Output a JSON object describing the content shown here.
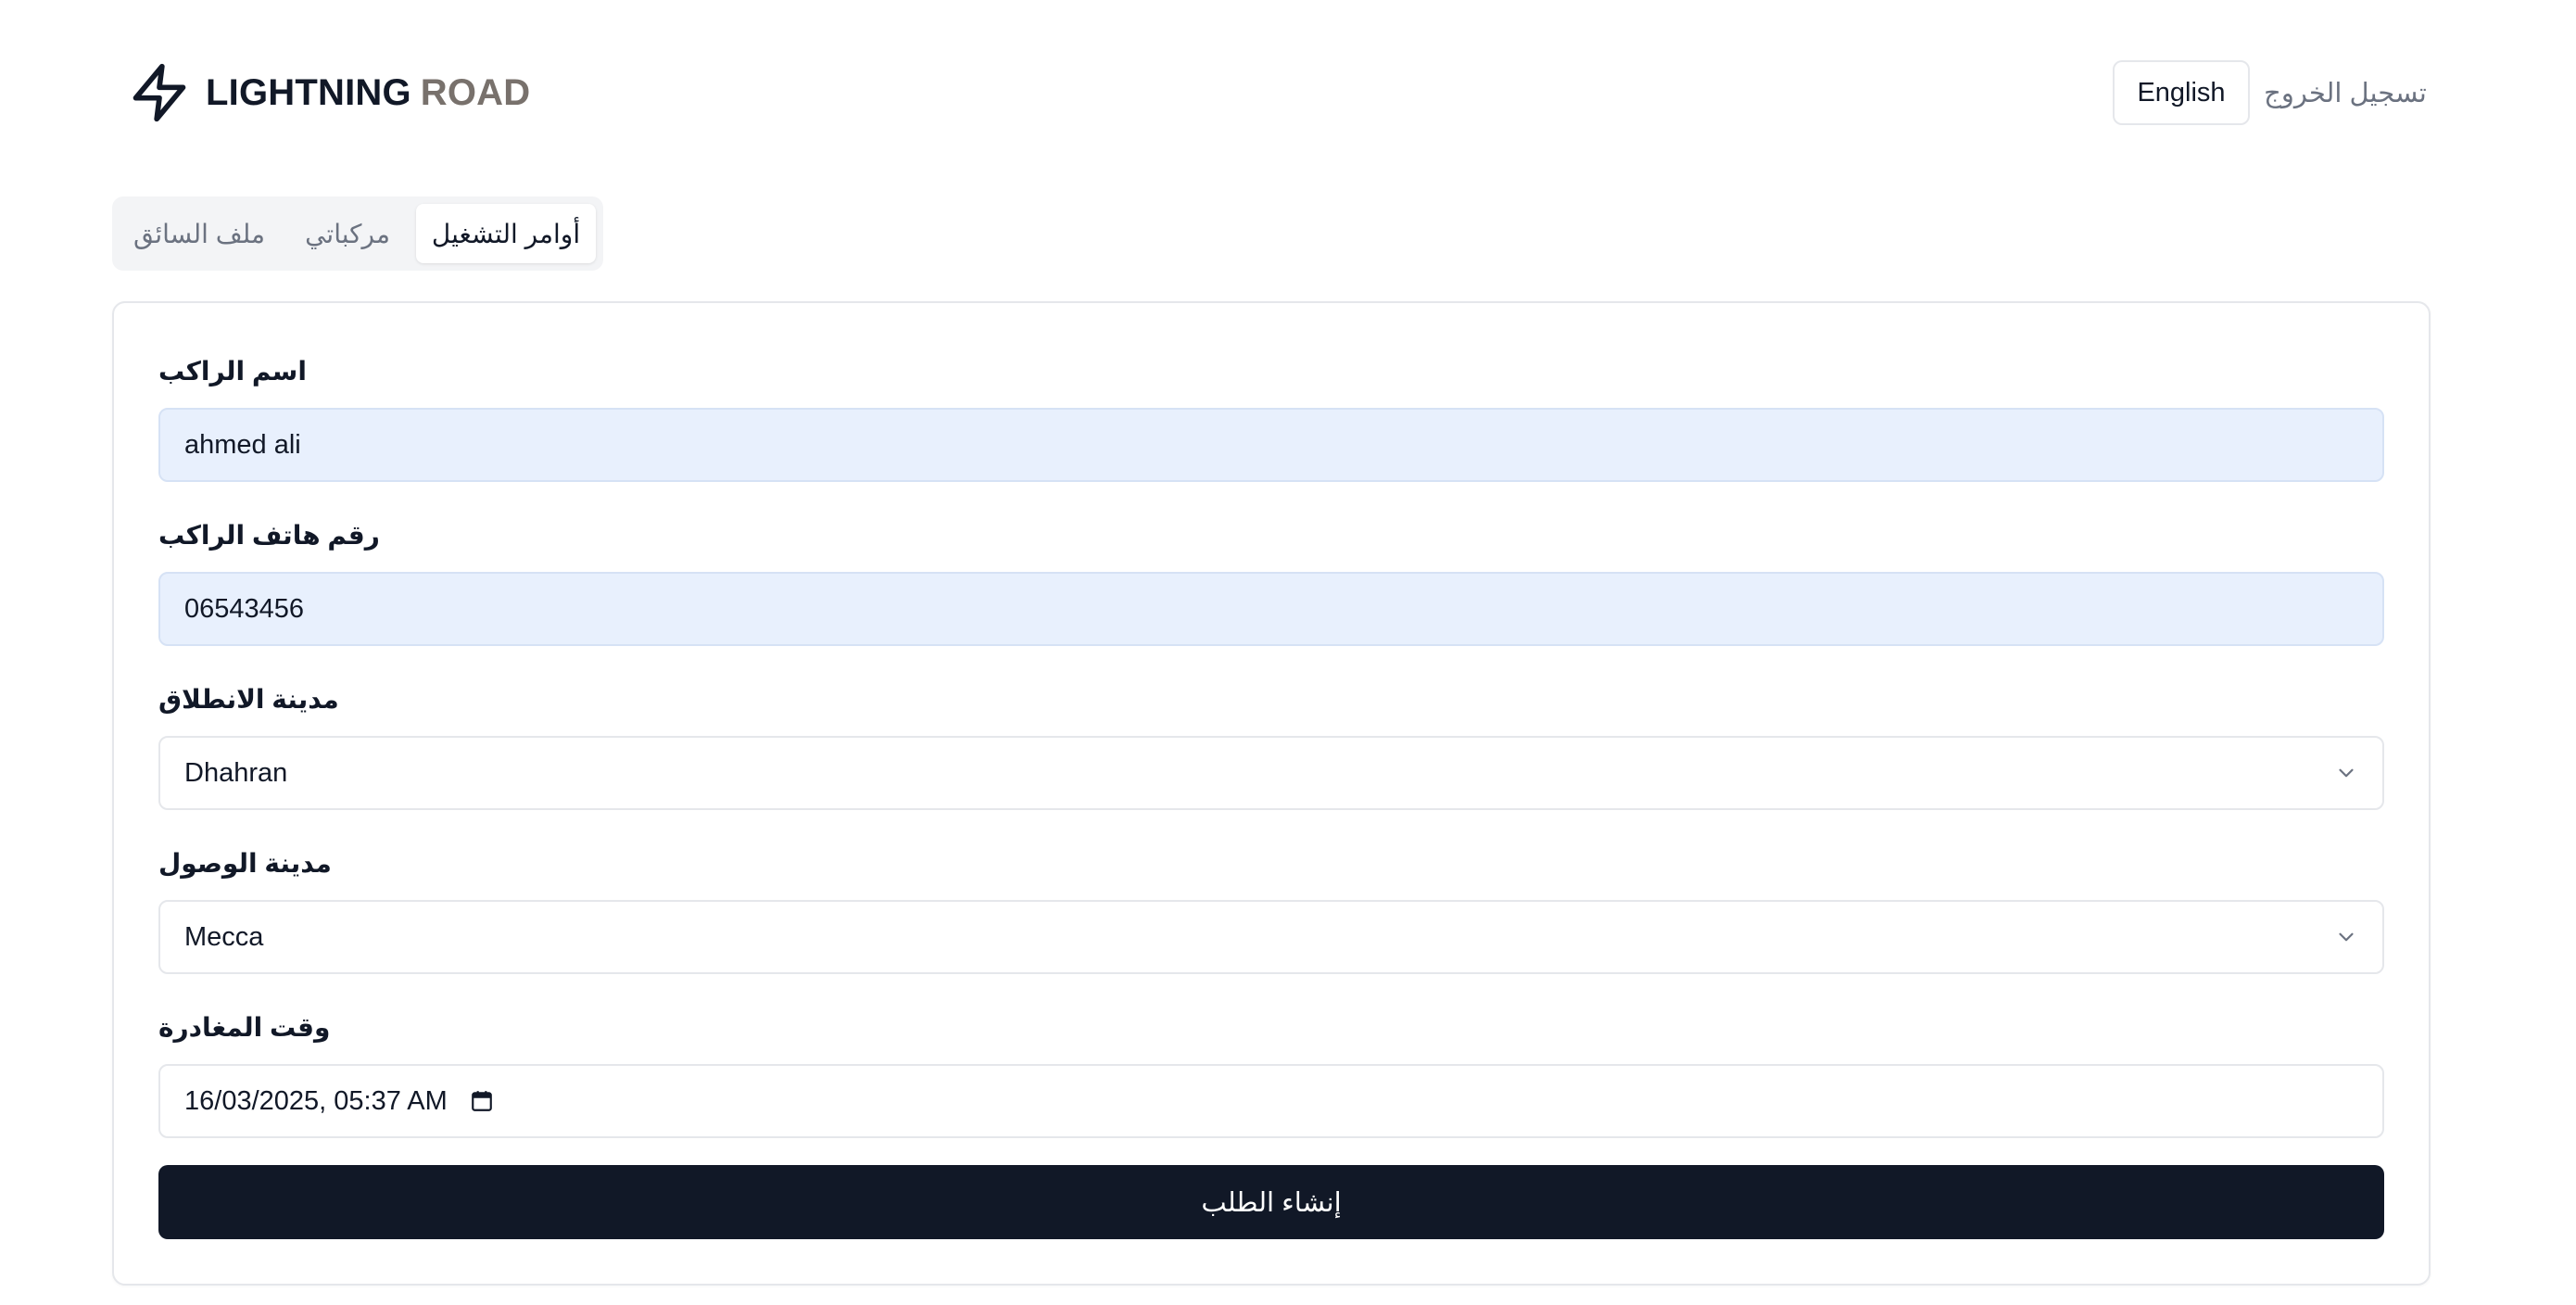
{
  "header": {
    "brand_word1": "LIGHTNING",
    "brand_word2": "ROAD",
    "language_button": "English",
    "logout_link": "تسجيل الخروج"
  },
  "tabs": [
    {
      "label": "أوامر التشغيل",
      "active": true
    },
    {
      "label": "مركباتي",
      "active": false
    },
    {
      "label": "ملف السائق",
      "active": false
    }
  ],
  "form": {
    "rider_name": {
      "label": "اسم الراكب",
      "value": "ahmed ali"
    },
    "rider_phone": {
      "label": "رقم هاتف الراكب",
      "value": "06543456"
    },
    "departure_city": {
      "label": "مدينة الانطلاق",
      "value": "Dhahran"
    },
    "arrival_city": {
      "label": "مدينة الوصول",
      "value": "Mecca"
    },
    "departure_time": {
      "label": "وقت المغادرة",
      "value": "16/03/2025, 05:37 AM"
    },
    "submit_label": "إنشاء الطلب"
  },
  "icons": {
    "logo": "lightning-bolt-icon",
    "select": "chevron-down-icon",
    "datetime": "calendar-icon"
  },
  "colors": {
    "primary": "#111827",
    "autofill_bg": "#e8f0fd",
    "muted_text": "#6b7280",
    "brand_secondary": "#78716c"
  }
}
